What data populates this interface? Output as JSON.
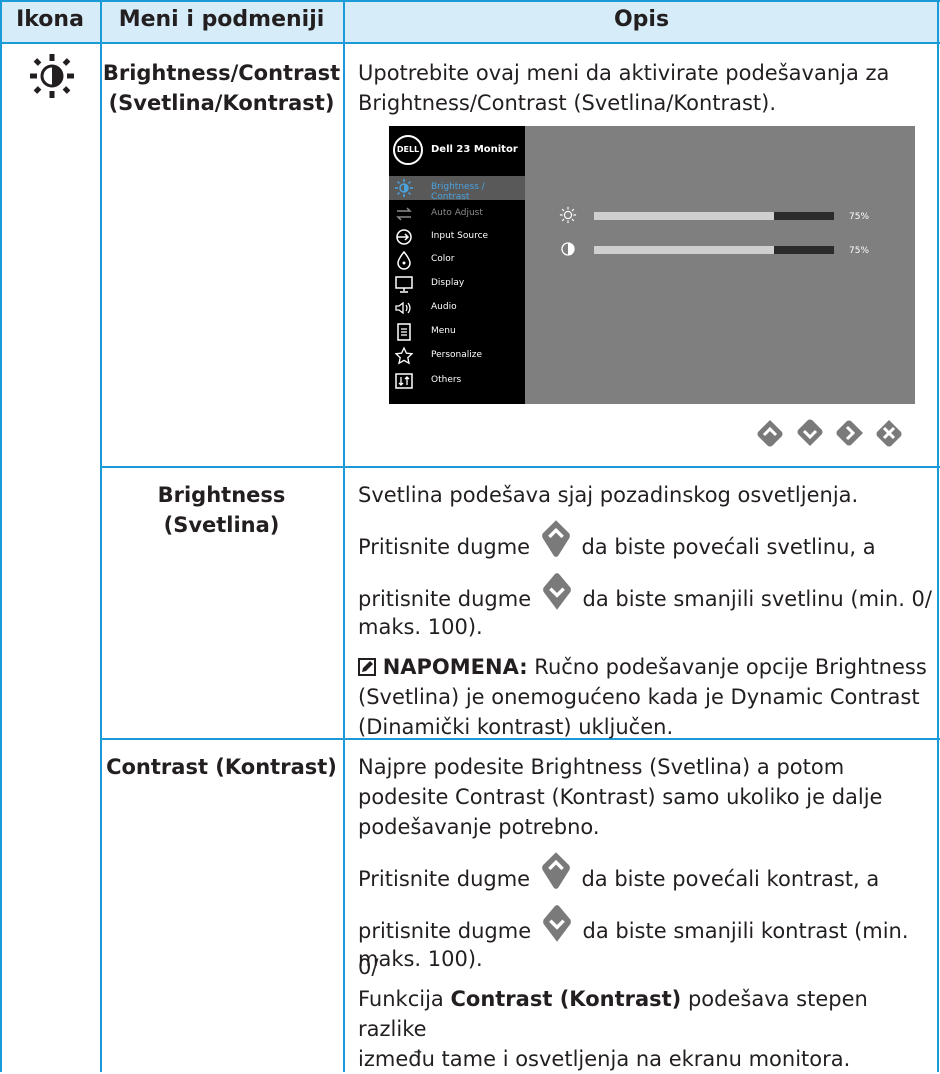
{
  "header": {
    "col1": "Ikona",
    "col2": "Meni i podmeniji",
    "col3": "Opis"
  },
  "rows": {
    "brightness_contrast": {
      "menu_line1": "Brightness/Contrast",
      "menu_line2": "(Svetlina/Kontrast)",
      "desc_line1": "Upotrebite ovaj meni da aktivirate podešavanja za",
      "desc_line2": "Brightness/Contrast (Svetlina/Kontrast)."
    },
    "brightness": {
      "menu": "Brightness (Svetlina)",
      "p1": "Svetlina podešava sjaj pozadinskog osvetljenja.",
      "p2a": "Pritisnite dugme",
      "p2b": "da biste povećali svetlinu, a",
      "p3a": "pritisnite dugme",
      "p3b": "da biste smanjili svetlinu (min. 0/",
      "p3c": "maks. 100).",
      "note_label": "NAPOMENA:",
      "note_line1": " Ručno podešavanje opcije Brightness",
      "note_line2": "(Svetlina) je onemogućeno kada je Dynamic Contrast",
      "note_line3": "(Dinamički kontrast) uključen."
    },
    "contrast": {
      "menu": "Contrast (Kontrast)",
      "p1_line1": "Najpre podesite Brightness (Svetlina) a potom",
      "p1_line2": "podesite Contrast (Kontrast) samo ukoliko je dalje",
      "p1_line3": "podešavanje potrebno.",
      "p2a": "Pritisnite dugme",
      "p2b": "da biste povećali kontrast, a",
      "p3a": "pritisnite dugme",
      "p3b": "da biste smanjili kontrast (min. 0/",
      "p3c": "maks. 100).",
      "p4_pre": "Funkcija ",
      "p4_bold": "Contrast (Kontrast)",
      "p4_post": " podešava stepen razlike",
      "p4_line2": "između tame i osvetljenja na ekranu monitora."
    }
  },
  "osd": {
    "logo": "DELL",
    "title": "Dell 23 Monitor",
    "items": [
      {
        "label": "Brightness / Contrast",
        "icon": "sun-icon"
      },
      {
        "label": "Auto Adjust",
        "icon": "arrows-icon"
      },
      {
        "label": "Input Source",
        "icon": "input-icon"
      },
      {
        "label": "Color",
        "icon": "color-icon"
      },
      {
        "label": "Display",
        "icon": "monitor-icon"
      },
      {
        "label": "Audio",
        "icon": "speaker-icon"
      },
      {
        "label": "Menu",
        "icon": "menu-icon"
      },
      {
        "label": "Personalize",
        "icon": "star-icon"
      },
      {
        "label": "Others",
        "icon": "others-icon"
      }
    ],
    "brightness_value": "75%",
    "contrast_value": "75%",
    "brightness_level": 0.75,
    "contrast_level": 0.75
  },
  "colors": {
    "accent": "#1a9bd7",
    "header_bg": "#d6ecf8",
    "icon_gray": "#7a7a7a"
  }
}
